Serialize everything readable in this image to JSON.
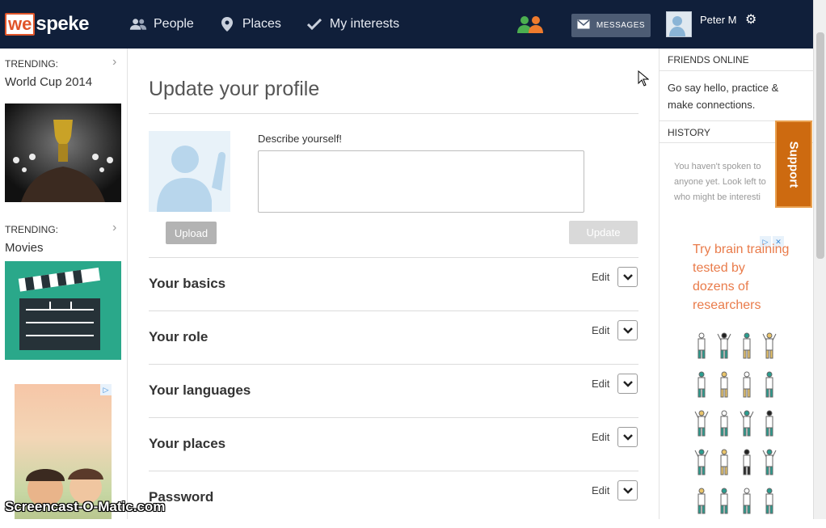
{
  "brand": {
    "logo_box": "we",
    "logo_text": "speke"
  },
  "nav": [
    {
      "label": "People",
      "icon": "people-icon"
    },
    {
      "label": "Places",
      "icon": "map-pin-icon"
    },
    {
      "label": "My interests",
      "icon": "checkmark-icon"
    }
  ],
  "header": {
    "messages_label": "MESSAGES",
    "user_name": "Peter M"
  },
  "left": {
    "trending": [
      {
        "label": "TRENDING:",
        "title": "World Cup 2014"
      },
      {
        "label": "TRENDING:",
        "title": "Movies"
      }
    ],
    "ad_badge": "▷"
  },
  "main": {
    "title": "Update your profile",
    "describe_label": "Describe yourself!",
    "describe_value": "",
    "upload_label": "Upload",
    "update_label": "Update",
    "edit_label": "Edit",
    "sections": [
      {
        "title": "Your basics"
      },
      {
        "title": "Your role"
      },
      {
        "title": "Your languages"
      },
      {
        "title": "Your places"
      },
      {
        "title": "Password"
      }
    ]
  },
  "right": {
    "friends_head": "FRIENDS ONLINE",
    "friends_text": "Go say hello, practice & make connections.",
    "history_head": "HISTORY",
    "history_lines": [
      "You haven't spoken to",
      "anyone yet. Look left to",
      "who might be interesti"
    ],
    "support_label": "Support",
    "ad_text": "Try brain training tested by dozens of researchers",
    "ad_badges": [
      "▷",
      "✕"
    ]
  },
  "watermark": "Screencast-O-Matic.com",
  "colors": {
    "topbar": "#101f3a",
    "accent_orange": "#e0552a",
    "support": "#cd6a10",
    "ad_text": "#e97b4a",
    "online_green": "#4caf50"
  }
}
